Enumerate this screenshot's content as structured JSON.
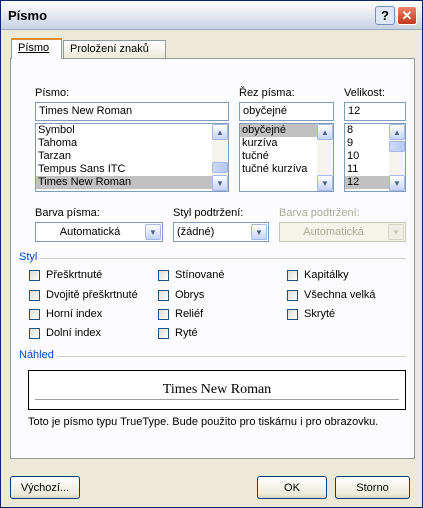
{
  "window": {
    "title": "Písmo"
  },
  "titlebar": {
    "help_glyph": "?",
    "close_glyph": "✕"
  },
  "tabs": [
    {
      "label": "Písmo"
    },
    {
      "label": "Proložení znaků"
    }
  ],
  "font": {
    "label": "Písmo:",
    "value": "Times New Roman",
    "items": [
      "Symbol",
      "Tahoma",
      "Tarzan",
      "Tempus Sans ITC",
      "Times New Roman"
    ],
    "selected": "Times New Roman"
  },
  "style": {
    "label": "Řez písma:",
    "value": "obyčejné",
    "items": [
      "obyčejné",
      "kurzíva",
      "tučné",
      "tučné kurzíva"
    ],
    "selected": "obyčejné"
  },
  "size": {
    "label": "Velikost:",
    "value": "12",
    "items": [
      "8",
      "9",
      "10",
      "11",
      "12"
    ],
    "selected": "12"
  },
  "color": {
    "label": "Barva písma:",
    "value": "Automatická"
  },
  "underline": {
    "label": "Styl podtržení:",
    "value": "(žádné)"
  },
  "underline_color": {
    "label": "Barva podtržení:",
    "value": "Automatická"
  },
  "effects": {
    "title": "Styl",
    "items": [
      {
        "label": "Přeškrtnuté",
        "checked": false
      },
      {
        "label": "Dvojitě přeškrtnuté",
        "checked": false
      },
      {
        "label": "Horní index",
        "checked": false
      },
      {
        "label": "Dolní index",
        "checked": false
      },
      {
        "label": "Stínované",
        "checked": false
      },
      {
        "label": "Obrys",
        "checked": false
      },
      {
        "label": "Reliéf",
        "checked": false
      },
      {
        "label": "Ryté",
        "checked": false
      },
      {
        "label": "Kapitálky",
        "checked": false
      },
      {
        "label": "Všechna velká",
        "checked": false
      },
      {
        "label": "Skryté",
        "checked": false
      }
    ]
  },
  "preview": {
    "title": "Náhled",
    "sample": "Times New Roman",
    "note": "Toto je písmo typu TrueType. Bude použito pro tiskárnu i pro obrazovku."
  },
  "buttons": {
    "default": "Výchozí...",
    "ok": "OK",
    "cancel": "Storno"
  }
}
